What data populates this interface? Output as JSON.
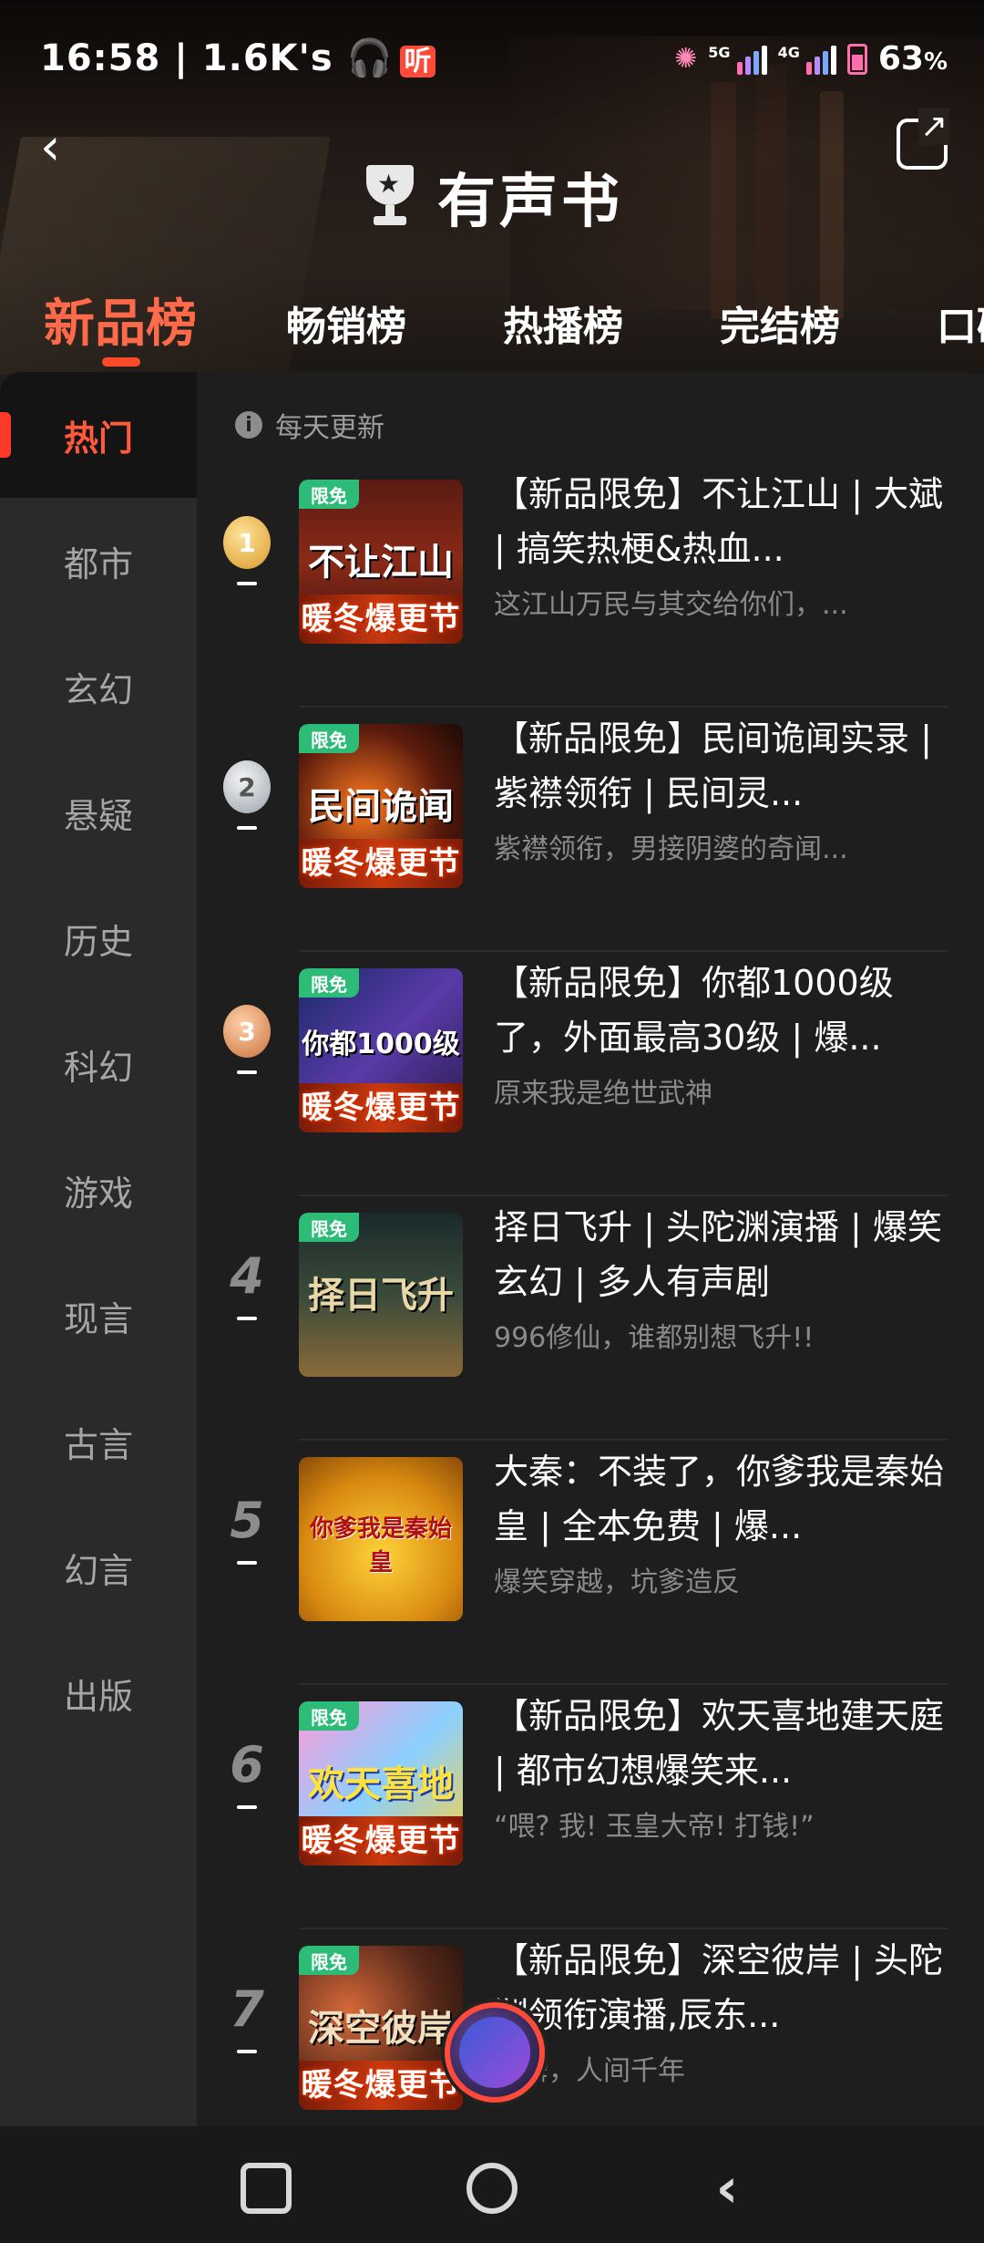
{
  "status_bar": {
    "time": "16:58",
    "speed": "1.6K's",
    "battery": "63",
    "battery_unit": "%",
    "net1": "5G",
    "net2": "4G"
  },
  "header": {
    "title": "有声书"
  },
  "tabs": [
    "新品榜",
    "畅销榜",
    "热播榜",
    "完结榜",
    "口碑"
  ],
  "active_tab": 0,
  "sidebar": [
    "热门",
    "都市",
    "玄幻",
    "悬疑",
    "历史",
    "科幻",
    "游戏",
    "现言",
    "古言",
    "幻言",
    "出版"
  ],
  "active_sidebar": 0,
  "update_note": "每天更新",
  "badge_label": "限免",
  "cover_band": "暖冬爆更节",
  "books": [
    {
      "rank": "1",
      "medal": "gold",
      "title": "【新品限免】不让江山 | 大斌 | 搞笑热梗&热血...",
      "desc": "这江山万民与其交给你们，...",
      "cover_text": "不让江山",
      "free": true
    },
    {
      "rank": "2",
      "medal": "silver",
      "title": "【新品限免】民间诡闻实录 | 紫襟领衔 | 民间灵...",
      "desc": "紫襟领衔，男接阴婆的奇闻...",
      "cover_text": "民间诡闻",
      "free": true
    },
    {
      "rank": "3",
      "medal": "bronze",
      "title": "【新品限免】你都1000级了，外面最高30级 | 爆...",
      "desc": "原来我是绝世武神",
      "cover_text": "你都1000级",
      "free": true
    },
    {
      "rank": "4",
      "medal": "",
      "title": "择日飞升 | 头陀渊演播 | 爆笑玄幻 | 多人有声剧",
      "desc": "996修仙，谁都别想飞升!!",
      "cover_text": "择日飞升",
      "free": true
    },
    {
      "rank": "5",
      "medal": "",
      "title": "大秦：不装了，你爹我是秦始皇 | 全本免费 | 爆...",
      "desc": "爆笑穿越，坑爹造反",
      "cover_text": "你爹我是秦始皇",
      "free": false
    },
    {
      "rank": "6",
      "medal": "",
      "title": "【新品限免】欢天喜地建天庭 | 都市幻想爆笑来...",
      "desc": "“喂? 我! 玉皇大帝! 打钱!”",
      "cover_text": "欢天喜地",
      "free": true
    },
    {
      "rank": "7",
      "medal": "",
      "title": "【新品限免】深空彼岸 | 头陀渊领衔演播,辰东...",
      "desc": "一瞬，人间千年",
      "cover_text": "深空彼岸",
      "free": true
    }
  ],
  "colors": {
    "accent": "#ff5a3a",
    "free_badge": "#2dbb78",
    "background": "#1e1e1f",
    "sidebar": "#2a2a2b"
  },
  "icons": {
    "back": "chevron-left-icon",
    "share": "share-icon",
    "trophy": "trophy-icon",
    "info": "info-icon"
  }
}
